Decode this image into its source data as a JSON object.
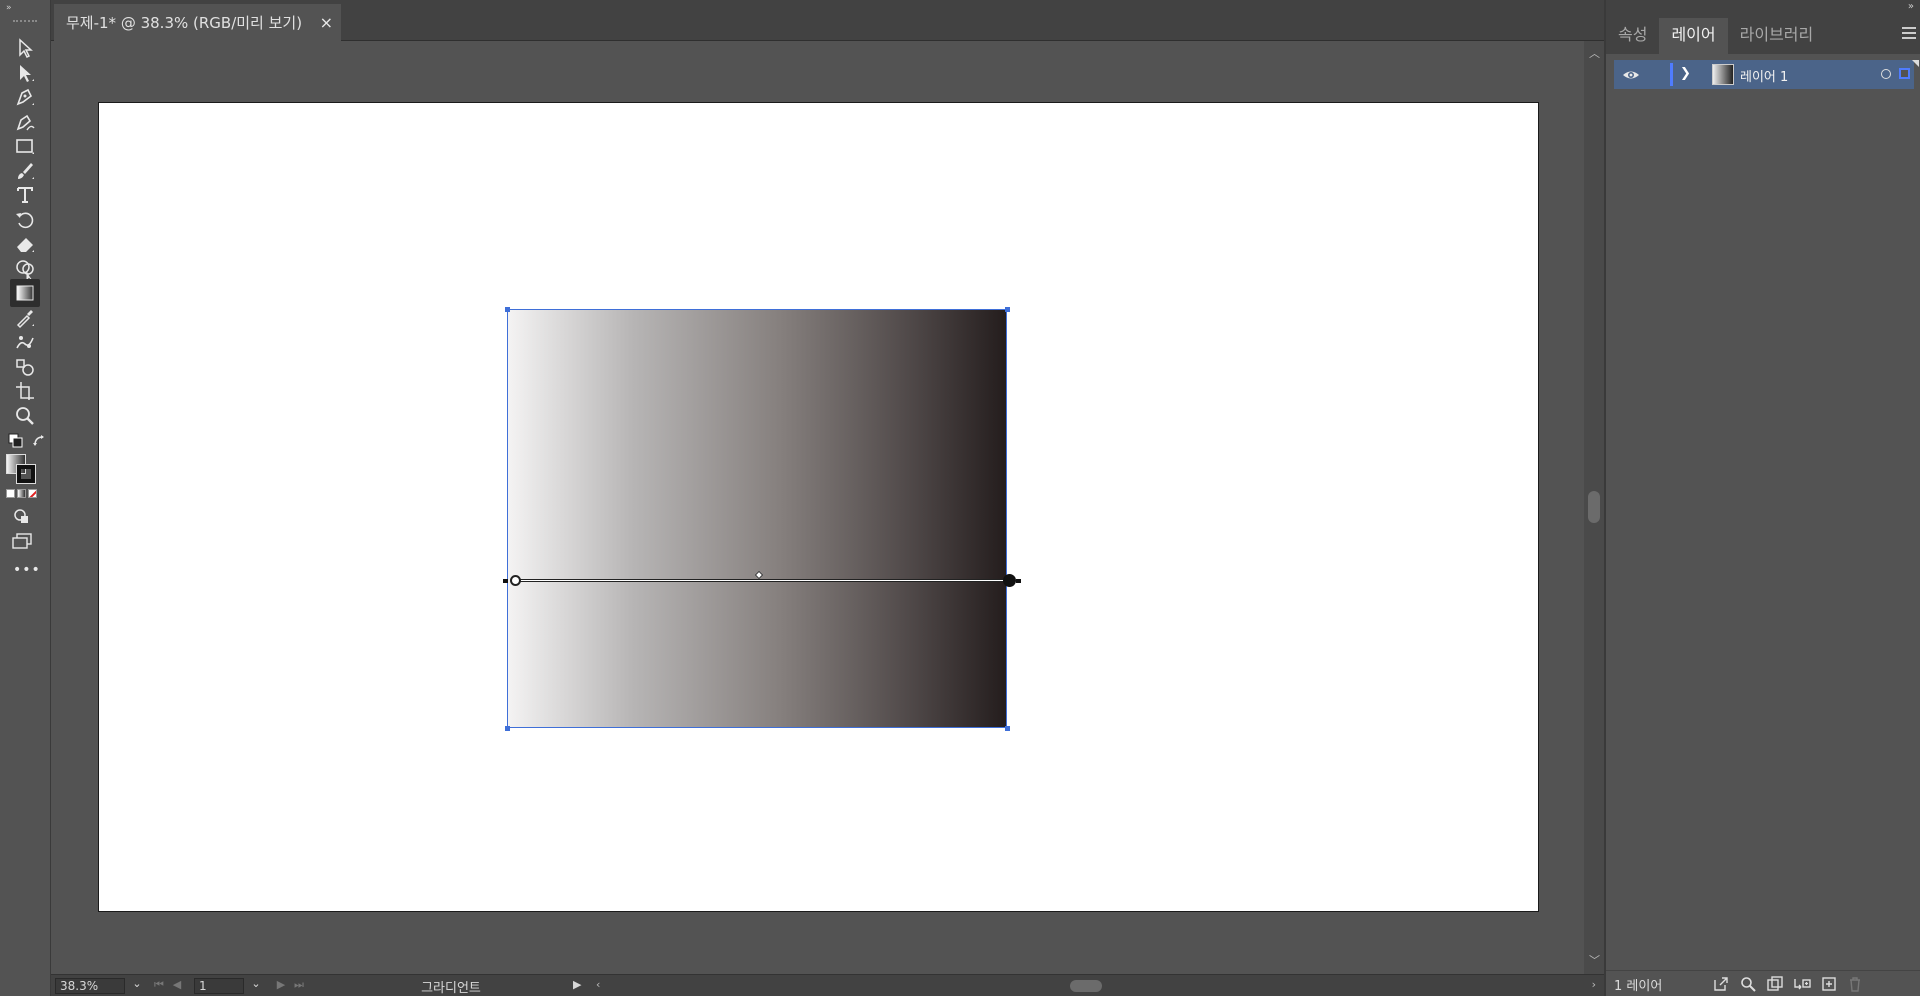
{
  "document": {
    "tab_title": "무제-1* @ 38.3% (RGB/미리 보기)",
    "close_glyph": "×"
  },
  "toolbar": {
    "tools": [
      {
        "name": "selection-tool",
        "icon": "arrow-icon"
      },
      {
        "name": "direct-selection-tool",
        "icon": "direct-arrow-icon"
      },
      {
        "name": "pen-tool",
        "icon": "pen-icon"
      },
      {
        "name": "curvature-tool",
        "icon": "curvature-icon"
      },
      {
        "name": "rectangle-tool",
        "icon": "rectangle-icon"
      },
      {
        "name": "paintbrush-tool",
        "icon": "brush-icon"
      },
      {
        "name": "type-tool",
        "icon": "type-icon"
      },
      {
        "name": "rotate-tool",
        "icon": "rotate-icon"
      },
      {
        "name": "eraser-tool",
        "icon": "eraser-icon"
      },
      {
        "name": "shape-builder-tool",
        "icon": "shape-builder-icon"
      },
      {
        "name": "gradient-tool",
        "icon": "gradient-icon",
        "active": true
      },
      {
        "name": "eyedropper-tool",
        "icon": "eyedropper-icon"
      },
      {
        "name": "puppet-warp-tool",
        "icon": "puppet-warp-icon"
      },
      {
        "name": "symbol-sprayer-tool",
        "icon": "symbol-icon"
      },
      {
        "name": "artboard-tool",
        "icon": "artboard-icon"
      },
      {
        "name": "zoom-tool",
        "icon": "zoom-icon"
      }
    ]
  },
  "statusbar": {
    "zoom": "38.3%",
    "page": "1",
    "current_tool": "그라디언트"
  },
  "panel": {
    "tabs": [
      "속성",
      "레이어",
      "라이브러리"
    ],
    "active_tab": "레이어",
    "layers": [
      {
        "name": "레이어 1",
        "visible": true,
        "color": "#4f7cff"
      }
    ],
    "layer_count": "1 레이어"
  },
  "artwork": {
    "gradient_start": "#f4f3f3",
    "gradient_end": "#241d1d",
    "selection_color": "#3f6fd8"
  }
}
